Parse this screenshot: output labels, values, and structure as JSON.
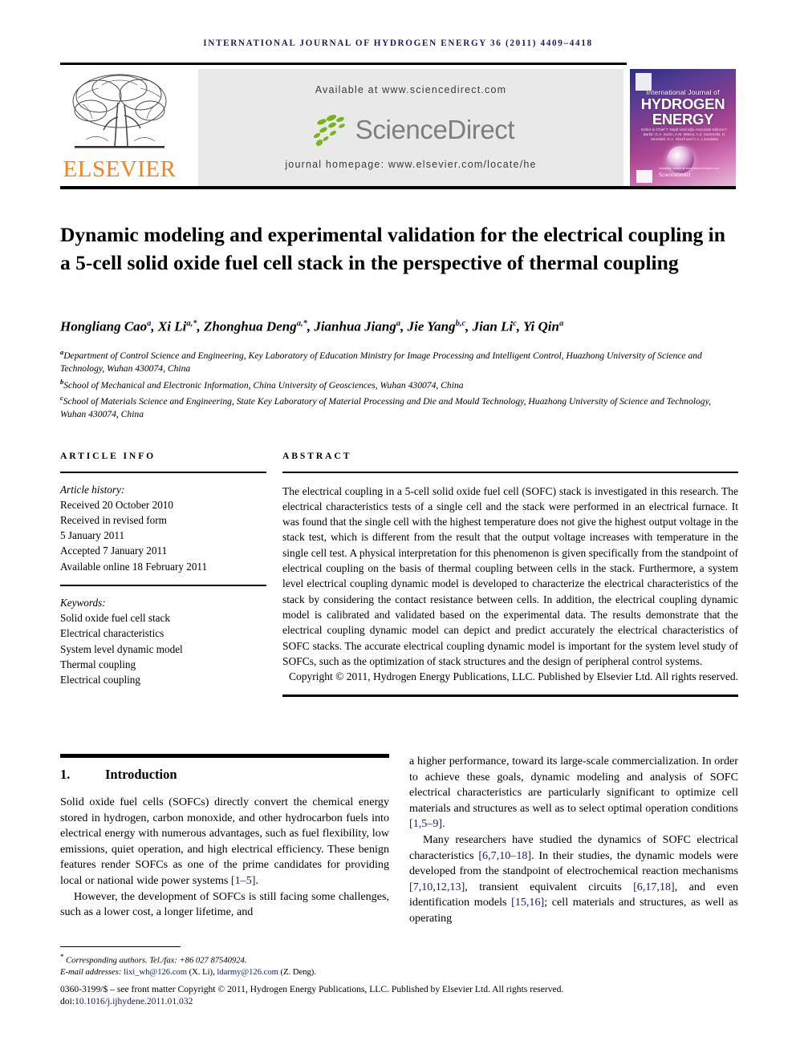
{
  "running_head": "International Journal of Hydrogen Energy 36 (2011) 4409–4418",
  "masthead": {
    "publisher_logo_label": "ELSEVIER",
    "publisher_logo_icon": "elsevier-tree-icon",
    "sciencedirect": {
      "available_at": "Available at www.sciencedirect.com",
      "logo_text": "ScienceDirect",
      "logo_icon": "sciencedirect-leaves-icon",
      "journal_homepage": "journal homepage: www.elsevier.com/locate/he"
    },
    "cover": {
      "line_journal": "International Journal of",
      "line_title_1": "HYDROGEN",
      "line_title_2": "ENERGY",
      "editors": "Editor-in-Chief  T. Nejat Veziroğlu\nAssociate Editors  F. Barbir, G.A. Karim, A.M. Mitsos, A.Z. Sammells, H. Steinfeld, G.A. Sherif and C.A. Linardakis",
      "footer_logo": "IAHE",
      "footer_brand": "ScienceDirect",
      "footer_tiny": "Available online at www.sciencedirect.com"
    }
  },
  "title": "Dynamic modeling and experimental validation for the electrical coupling in a 5-cell solid oxide fuel cell stack in the perspective of thermal coupling",
  "authors": [
    {
      "name": "Hongliang Cao",
      "marks": "a"
    },
    {
      "name": "Xi Li",
      "marks": "a,*"
    },
    {
      "name": "Zhonghua Deng",
      "marks": "a,*"
    },
    {
      "name": "Jianhua Jiang",
      "marks": "a"
    },
    {
      "name": "Jie Yang",
      "marks": "b,c"
    },
    {
      "name": "Jian Li",
      "marks": "c"
    },
    {
      "name": "Yi Qin",
      "marks": "a"
    }
  ],
  "affiliations": [
    {
      "mark": "a",
      "text": "Department of Control Science and Engineering, Key Laboratory of Education Ministry for Image Processing and Intelligent Control, Huazhong University of Science and Technology, Wuhan 430074, China"
    },
    {
      "mark": "b",
      "text": "School of Mechanical and Electronic Information, China University of Geosciences, Wuhan 430074, China"
    },
    {
      "mark": "c",
      "text": "School of Materials Science and Engineering, State Key Laboratory of Material Processing and Die and Mould Technology, Huazhong University of Science and Technology, Wuhan 430074, China"
    }
  ],
  "article_info": {
    "heading": "ARTICLE INFO",
    "history_label": "Article history:",
    "history": [
      "Received 20 October 2010",
      "Received in revised form",
      "5 January 2011",
      "Accepted 7 January 2011",
      "Available online 18 February 2011"
    ],
    "keywords_label": "Keywords:",
    "keywords": [
      "Solid oxide fuel cell stack",
      "Electrical characteristics",
      "System level dynamic model",
      "Thermal coupling",
      "Electrical coupling"
    ]
  },
  "abstract": {
    "heading": "ABSTRACT",
    "text": "The electrical coupling in a 5-cell solid oxide fuel cell (SOFC) stack is investigated in this research. The electrical characteristics tests of a single cell and the stack were performed in an electrical furnace. It was found that the single cell with the highest temperature does not give the highest output voltage in the stack test, which is different from the result that the output voltage increases with temperature in the single cell test. A physical interpretation for this phenomenon is given specifically from the standpoint of electrical coupling on the basis of thermal coupling between cells in the stack. Furthermore, a system level electrical coupling dynamic model is developed to characterize the electrical characteristics of the stack by considering the contact resistance between cells. In addition, the electrical coupling dynamic model is calibrated and validated based on the experimental data. The results demonstrate that the electrical coupling dynamic model can depict and predict accurately the electrical characteristics of SOFC stacks. The accurate electrical coupling dynamic model is important for the system level study of SOFCs, such as the optimization of stack structures and the design of peripheral control systems.",
    "copyright": "Copyright © 2011, Hydrogen Energy Publications, LLC. Published by Elsevier Ltd. All rights reserved."
  },
  "section": {
    "number": "1.",
    "heading": "Introduction"
  },
  "body": {
    "left": [
      {
        "indent": false,
        "parts": [
          {
            "t": "Solid oxide fuel cells (SOFCs) directly convert the chemical energy stored in hydrogen, carbon monoxide, and other hydrocarbon fuels into electrical energy with numerous advantages, such as fuel flexibility, low emissions, quiet operation, and high electrical efficiency. These benign features render SOFCs as one of the prime candidates for providing local or national wide power systems "
          },
          {
            "t": "[1–5]",
            "ref": true
          },
          {
            "t": "."
          }
        ]
      },
      {
        "indent": true,
        "parts": [
          {
            "t": "However, the development of SOFCs is still facing some challenges, such as a lower cost, a longer lifetime, and"
          }
        ]
      }
    ],
    "right": [
      {
        "indent": false,
        "parts": [
          {
            "t": "a higher performance, toward its large-scale commercialization. In order to achieve these goals, dynamic modeling and analysis of SOFC electrical characteristics are particularly significant to optimize cell materials and structures as well as to select optimal operation conditions "
          },
          {
            "t": "[1,5–9]",
            "ref": true
          },
          {
            "t": "."
          }
        ]
      },
      {
        "indent": true,
        "parts": [
          {
            "t": "Many researchers have studied the dynamics of SOFC electrical characteristics "
          },
          {
            "t": "[6,7,10–18]",
            "ref": true
          },
          {
            "t": ". In their studies, the dynamic models were developed from the standpoint of electrochemical reaction mechanisms "
          },
          {
            "t": "[7,10,12,13]",
            "ref": true
          },
          {
            "t": ", transient equivalent circuits "
          },
          {
            "t": "[6,17,18]",
            "ref": true
          },
          {
            "t": ", and even identification models "
          },
          {
            "t": "[15,16]",
            "ref": true
          },
          {
            "t": "; cell materials and structures, as well as operating"
          }
        ]
      }
    ]
  },
  "footnotes": {
    "corresponding": "Corresponding authors. Tel./fax: +86 027 87540924.",
    "email_label": "E-mail addresses:",
    "emails": [
      {
        "address": "lixi_wh@126.com",
        "who": "(X. Li)"
      },
      {
        "address": "ldarmy@126.com",
        "who": "(Z. Deng)"
      }
    ],
    "issn_line": "0360-3199/$ – see front matter Copyright © 2011, Hydrogen Energy Publications, LLC. Published by Elsevier Ltd. All rights reserved.",
    "doi_prefix": "doi:",
    "doi": "10.1016/j.ijhydene.2011.01.032"
  },
  "colors": {
    "link": "#1b1b64",
    "elsevier_orange": "#F58220",
    "banner_gray": "#e9e9e9",
    "sciencedirect_green": "#7ab317",
    "sciencedirect_gray": "#7e7e7e"
  }
}
